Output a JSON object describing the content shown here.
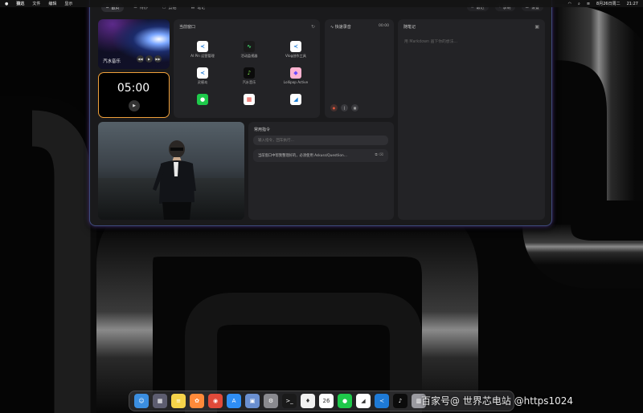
{
  "menubar": {
    "items": [
      "猿达",
      "文件",
      "编辑",
      "显示"
    ],
    "date": "8月26日周二",
    "clock": "21:27"
  },
  "toolbar": {
    "tabs": [
      {
        "label": "首页",
        "icon": "home-icon",
        "active": true
      },
      {
        "label": "待办",
        "icon": "list-icon",
        "active": false
      },
      {
        "label": "剪贴",
        "icon": "clipboard-icon",
        "active": false
      },
      {
        "label": "笔记",
        "icon": "note-icon",
        "active": false
      }
    ],
    "right": [
      {
        "label": "最近",
        "icon": "link-icon"
      },
      {
        "label": "录制",
        "icon": "mic-icon"
      },
      {
        "label": "设置",
        "icon": "sliders-icon"
      }
    ]
  },
  "music": {
    "title": "汽水音乐",
    "controls": [
      "◀◀",
      "▶",
      "▶▶"
    ]
  },
  "timer": {
    "value": "05:00"
  },
  "apps": {
    "title": "当前窗口",
    "items": [
      {
        "label": "AI Pin 运营管理",
        "icon": "vscode-icon",
        "bg": "#ffffff",
        "fg": "#1e7ad6",
        "glyph": "≺"
      },
      {
        "label": "活动监视器",
        "icon": "activity-monitor-icon",
        "bg": "#1a1a1a",
        "fg": "#3ed46a",
        "glyph": "∿"
      },
      {
        "label": "Vlog创作工具",
        "icon": "vscode-icon",
        "bg": "#ffffff",
        "fg": "#1e7ad6",
        "glyph": "≺"
      },
      {
        "label": "灵感岛",
        "icon": "vscode-icon",
        "bg": "#ffffff",
        "fg": "#1e7ad6",
        "glyph": "≺"
      },
      {
        "label": "汽水音乐",
        "icon": "music-app-icon",
        "bg": "#0b0b0b",
        "fg": "#7ee84a",
        "glyph": "♪"
      },
      {
        "label": "Lollipop Active",
        "icon": "lollipop-icon",
        "bg": "#ffb3d1",
        "fg": "#6a4aff",
        "glyph": "◆"
      },
      {
        "label": "",
        "icon": "wechat-icon",
        "bg": "#1ec94a",
        "fg": "#ffffff",
        "glyph": "●"
      },
      {
        "label": "",
        "icon": "calendar-icon",
        "bg": "#ffffff",
        "fg": "#e8413a",
        "glyph": "▦"
      },
      {
        "label": "",
        "icon": "mail-app-icon",
        "bg": "#ffffff",
        "fg": "#1a7fd6",
        "glyph": "◢"
      }
    ]
  },
  "voice": {
    "title": "快速录音",
    "time": "00:00"
  },
  "notes": {
    "title": "随笔记",
    "placeholder": "用 Markdown 画下你的想法…"
  },
  "command": {
    "title": "常用指令",
    "placeholder": "输入指令，回车执行…",
    "history": "当前窗口中帮我整理好的，必须使用 Askuss/Questlion…"
  },
  "dock": {
    "apps": [
      {
        "icon": "finder-icon",
        "bg": "#3b8ee0",
        "glyph": "☺"
      },
      {
        "icon": "launchpad-icon",
        "bg": "#5d5d70",
        "glyph": "▦"
      },
      {
        "icon": "notes-icon",
        "bg": "#f5d34a",
        "glyph": "≡"
      },
      {
        "icon": "photos-icon",
        "bg": "#ff8a3a",
        "glyph": "✿"
      },
      {
        "icon": "chrome-icon",
        "bg": "#e04a3a",
        "glyph": "◉"
      },
      {
        "icon": "app-store-icon",
        "bg": "#2f8ef5",
        "glyph": "A"
      },
      {
        "icon": "preview-icon",
        "bg": "#6a8fd0",
        "glyph": "▣"
      },
      {
        "icon": "system-settings-icon",
        "bg": "#8a8a8f",
        "glyph": "⚙"
      },
      {
        "icon": "terminal-icon",
        "bg": "#1a1a1a",
        "glyph": ">_"
      },
      {
        "icon": "voice-memos-icon",
        "bg": "#f0f0f0",
        "glyph": "♦"
      },
      {
        "icon": "calendar-icon",
        "bg": "#ffffff",
        "glyph": "26"
      },
      {
        "icon": "wechat-icon",
        "bg": "#1ec94a",
        "glyph": "●"
      },
      {
        "icon": "mail-app-icon",
        "bg": "#ffffff",
        "glyph": "◢"
      },
      {
        "icon": "vscode-icon",
        "bg": "#1e7ad6",
        "glyph": "≺"
      },
      {
        "icon": "music-app-icon",
        "bg": "#0b0b0b",
        "glyph": "♪"
      },
      {
        "icon": "trash-icon",
        "bg": "#9a9aa0",
        "glyph": "▥"
      }
    ]
  },
  "watermark": "百家号@ 世界芯电站 @https1024"
}
